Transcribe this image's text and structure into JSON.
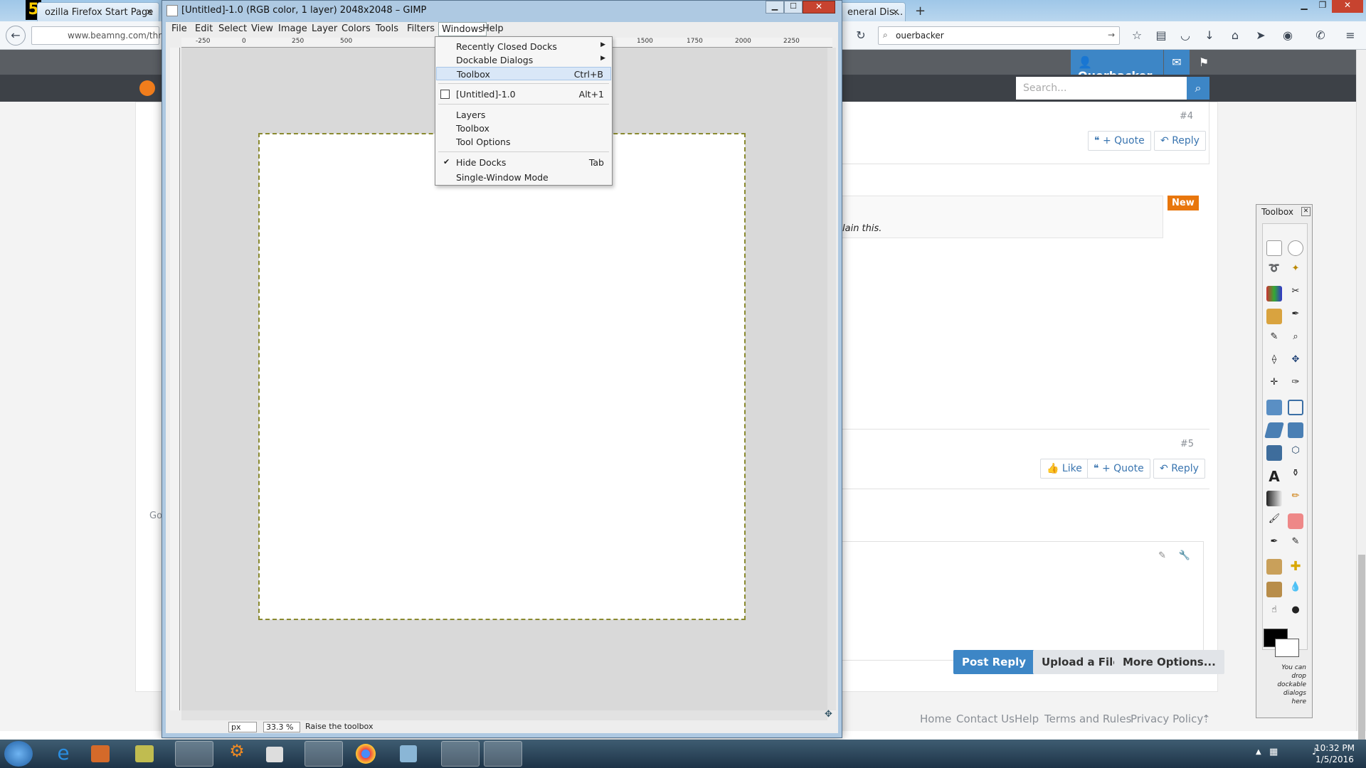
{
  "browser": {
    "tabs": [
      {
        "label": "ozilla Firefox Start Page"
      },
      {
        "label": "eneral Dis..."
      }
    ],
    "url": "www.beamng.com/thre",
    "search_value": "ouerbacker"
  },
  "site": {
    "username": "Ouerbacker",
    "search_placeholder": "Search...",
    "post4": {
      "number": "#4",
      "quote": "+ Quote",
      "reply": "Reply"
    },
    "new_badge": "New",
    "quote_text": "lain this.",
    "post5": {
      "number": "#5",
      "like": "Like",
      "quote": "+ Quote",
      "reply": "Reply"
    },
    "editor_prefix": "Go",
    "buttons": {
      "post_reply": "Post Reply",
      "upload": "Upload a File",
      "more": "More Options..."
    },
    "footer": [
      "Home",
      "Contact Us",
      "Help",
      "Terms and Rules",
      "Privacy Policy"
    ]
  },
  "gimp": {
    "title": "[Untitled]-1.0 (RGB color, 1 layer) 2048x2048 – GIMP",
    "menu": [
      "File",
      "Edit",
      "Select",
      "View",
      "Image",
      "Layer",
      "Colors",
      "Tools",
      "Filters",
      "Windows",
      "Help"
    ],
    "ruler_labels": [
      "-250",
      "0",
      "250",
      "500",
      "1500",
      "1750",
      "2000",
      "2250"
    ],
    "windows_menu": [
      {
        "label": "Recently Closed Docks",
        "submenu": true
      },
      {
        "label": "Dockable Dialogs",
        "submenu": true
      },
      {
        "label": "Toolbox",
        "accel": "Ctrl+B",
        "highlighted": true
      },
      {
        "label": "[Untitled]-1.0",
        "accel": "Alt+1"
      },
      {
        "label": "Layers"
      },
      {
        "label": "Toolbox"
      },
      {
        "label": "Tool Options"
      },
      {
        "label": "Hide Docks",
        "accel": "Tab",
        "checked": true
      },
      {
        "label": "Single-Window Mode"
      }
    ],
    "status": {
      "unit": "px",
      "zoom": "33.3 %",
      "message": "Raise the toolbox"
    }
  },
  "toolbox": {
    "title": "Toolbox",
    "drop_hint": "You can drop dockable dialogs here",
    "fg_color": "#000000",
    "bg_color": "#ffffff"
  },
  "taskbar": {
    "time": "10:32 PM",
    "date": "1/5/2016"
  },
  "colors": {
    "site_blue": "#3a75b0",
    "new_orange": "#e8760c",
    "user_blue": "#3d86c6"
  }
}
